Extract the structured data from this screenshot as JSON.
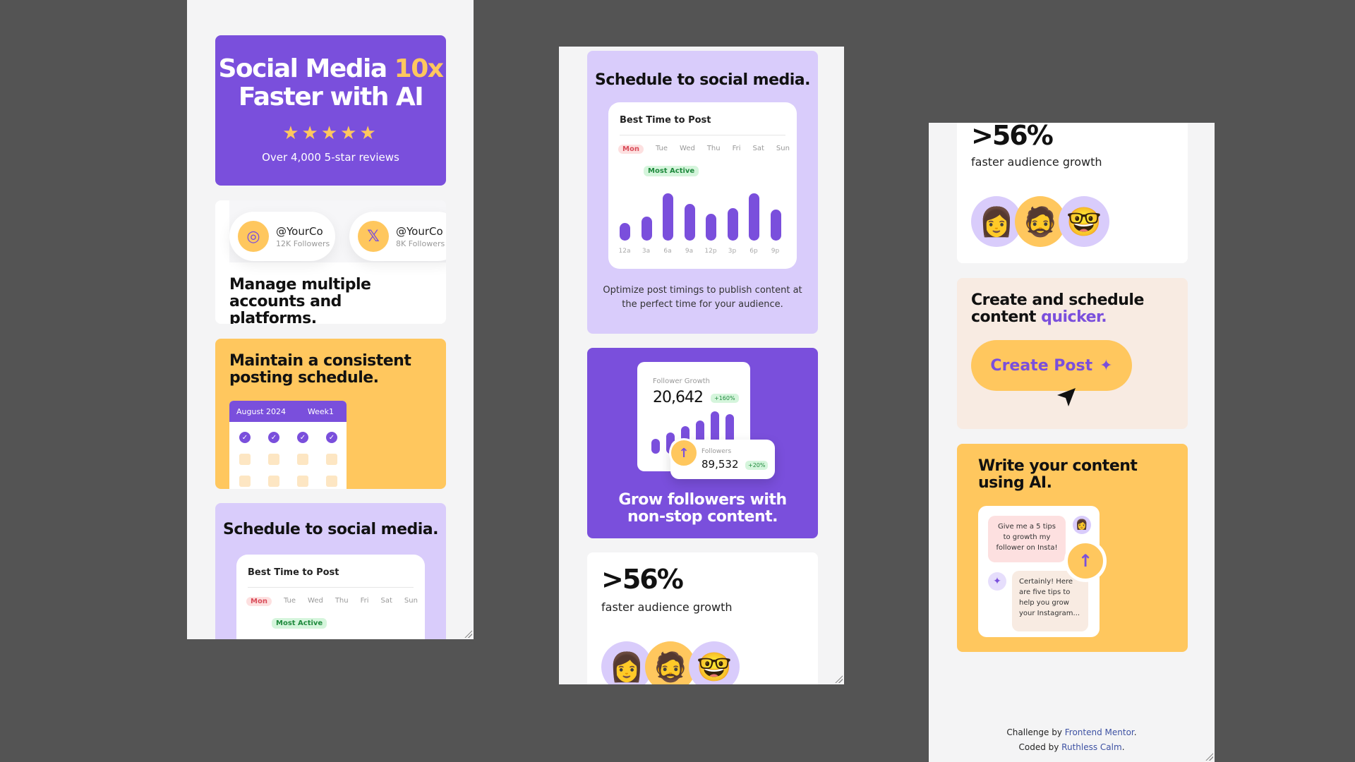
{
  "hero": {
    "title_pre": "Social Media ",
    "title_highlight": "10x",
    "title_post": "Faster with AI",
    "stars": "★★★★★",
    "reviews": "Over 4,000 5-star reviews"
  },
  "accounts": {
    "items": [
      {
        "icon": "instagram-icon",
        "glyph": "◎",
        "handle": "@YourCo",
        "followers": "12K Followers"
      },
      {
        "icon": "x-icon",
        "glyph": "𝕏",
        "handle": "@YourCo",
        "followers": "8K Followers"
      }
    ],
    "heading": "Manage multiple accounts and platforms."
  },
  "schedule_card": {
    "heading": "Maintain a consistent posting schedule.",
    "month": "August 2024",
    "week": "Week1"
  },
  "social": {
    "heading": "Schedule to social media.",
    "chart_title": "Best Time to Post",
    "days": [
      "Mon",
      "Tue",
      "Wed",
      "Thu",
      "Fri",
      "Sat",
      "Sun"
    ],
    "badge": "Most Active",
    "hours": [
      "12a",
      "3a",
      "6a",
      "9a",
      "12p",
      "3p",
      "6p",
      "9p"
    ],
    "caption": "Optimize post timings to publish content at the perfect time for your audience."
  },
  "growth": {
    "label": "Follower Growth",
    "value": "20,642",
    "change": "+160%",
    "followers_label": "Followers",
    "followers_value": "89,532",
    "followers_change": "+20%",
    "heading": "Grow followers with non-stop content."
  },
  "stat": {
    "value": ">56%",
    "label": "faster audience growth"
  },
  "create": {
    "heading_pre": "Create and schedule content ",
    "heading_accent": "quicker.",
    "button": "Create Post"
  },
  "ai": {
    "heading": "Write your content using AI.",
    "prompt": "Give me a 5 tips to growth my follower on Insta!",
    "reply": "Certainly! Here are five tips to help you grow your Instagram..."
  },
  "footer": {
    "challenge_pre": "Challenge by ",
    "challenge_link": "Frontend Mentor",
    "coded_pre": "Coded by ",
    "coded_link": "Ruthless Calm"
  },
  "colors": {
    "purple": "#7a4fdc",
    "yellow": "#ffc75e",
    "lilac": "#d9ccfb"
  },
  "chart_data": {
    "type": "bar",
    "title": "Best Time to Post",
    "categories": [
      "12a",
      "3a",
      "6a",
      "9a",
      "12p",
      "3p",
      "6p",
      "9p"
    ],
    "values": [
      30,
      40,
      80,
      62,
      45,
      55,
      80,
      52
    ],
    "ylim": [
      0,
      100
    ]
  },
  "growth_chart": {
    "type": "bar",
    "values": [
      25,
      35,
      45,
      55,
      70,
      65
    ]
  }
}
